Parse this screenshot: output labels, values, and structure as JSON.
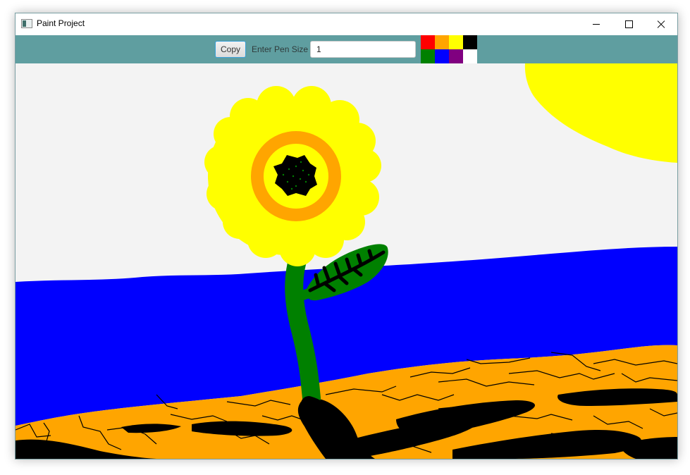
{
  "window": {
    "title": "Paint Project"
  },
  "titlebar_icons": {
    "minimize": "minimize-icon",
    "maximize": "maximize-icon",
    "close": "close-icon"
  },
  "toolbar": {
    "copy_label": "Copy",
    "pen_size_label": "Enter Pen Size",
    "pen_size_value": "1"
  },
  "palette": [
    {
      "name": "red",
      "color": "#ff0000"
    },
    {
      "name": "orange",
      "color": "#ffa500"
    },
    {
      "name": "yellow",
      "color": "#ffff00"
    },
    {
      "name": "black",
      "color": "#000000"
    },
    {
      "name": "green",
      "color": "#008000"
    },
    {
      "name": "blue",
      "color": "#0000ff"
    },
    {
      "name": "purple",
      "color": "#800080"
    },
    {
      "name": "white",
      "color": "#ffffff"
    }
  ],
  "colors": {
    "toolbar_background": "#5f9ea0",
    "canvas_background": "#f3f3f3"
  }
}
